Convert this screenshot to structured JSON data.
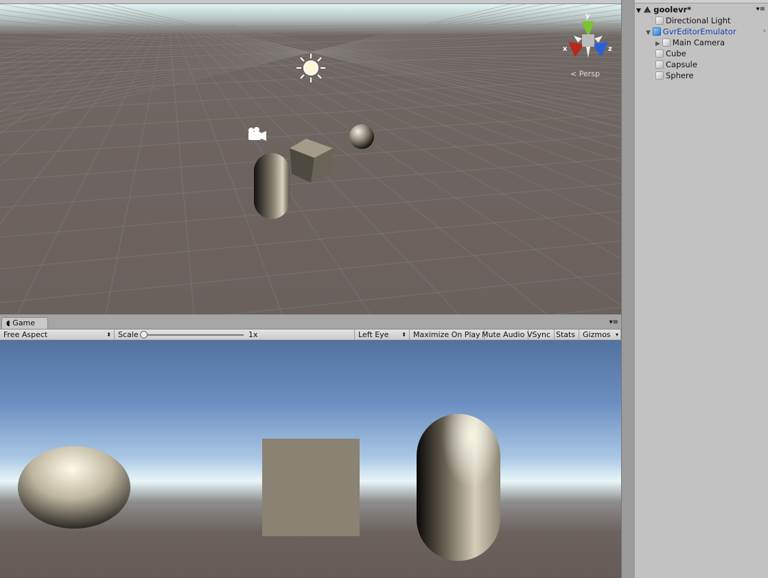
{
  "scene": {
    "projection_label": "Persp",
    "axes": {
      "x": "x",
      "y": "y",
      "z": "z"
    }
  },
  "game": {
    "tab_label": "Game",
    "aspect": "Free Aspect",
    "scale_label": "Scale",
    "scale_value": "1x",
    "scale_fraction": 0,
    "eye": "Left Eye",
    "maximize": "Maximize On Play",
    "mute": "Mute Audio",
    "vsync": "VSync",
    "stats": "Stats",
    "gizmos": "Gizmos"
  },
  "hierarchy": {
    "scene_name": "goolevr*",
    "items": [
      {
        "label": "Directional Light",
        "depth": 1
      },
      {
        "label": "GvrEditorEmulator",
        "depth": 1,
        "prefab": true,
        "color": "#1a3fb0"
      },
      {
        "label": "Main Camera",
        "depth": 2
      },
      {
        "label": "Cube",
        "depth": 1
      },
      {
        "label": "Capsule",
        "depth": 1
      },
      {
        "label": "Sphere",
        "depth": 1
      }
    ]
  }
}
